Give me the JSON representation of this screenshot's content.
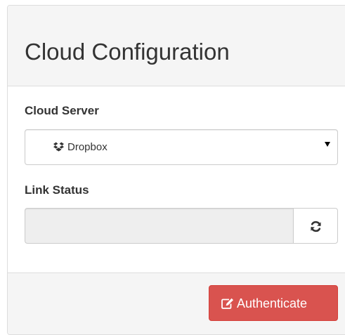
{
  "panel": {
    "title": "Cloud Configuration"
  },
  "cloud_server": {
    "label": "Cloud Server",
    "selected_value": "Dropbox",
    "selected_icon": "dropbox-icon",
    "caret_icon": "caret-down-icon"
  },
  "link_status": {
    "label": "Link Status",
    "value": "",
    "refresh_icon": "refresh-icon"
  },
  "footer": {
    "authenticate_label": "Authenticate",
    "authenticate_icon": "edit-icon"
  },
  "colors": {
    "panel_background": "#f5f5f5",
    "border": "#dddddd",
    "danger_button": "#d9534f",
    "disabled_input": "#eeeeee",
    "text": "#333333"
  }
}
